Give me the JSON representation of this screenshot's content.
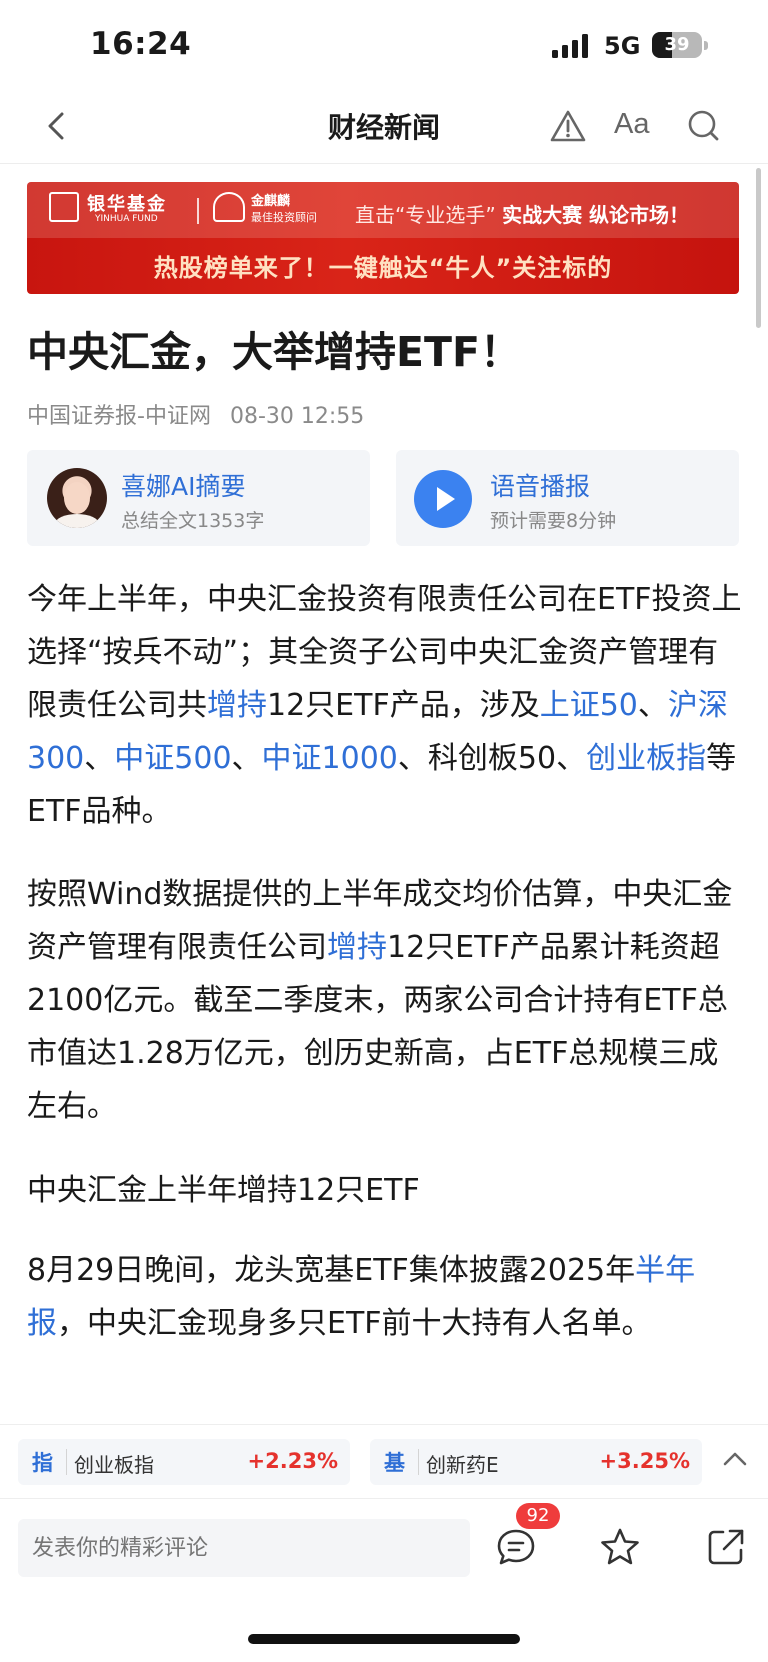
{
  "status_bar": {
    "time": "16:24",
    "network": "5G",
    "battery": "39",
    "battery_level": 0.39
  },
  "nav": {
    "title": "财经新闻",
    "font_button": "Aa"
  },
  "banner": {
    "logo1_cn": "银华基金",
    "logo1_en": "YINHUA FUND",
    "logo2_name": "金麒麟",
    "logo2_sub": "最佳投资顾问",
    "slogan_prefix": "直击“专业选手”",
    "slogan_bold": "实战大赛 纵论市场！",
    "headline": "热股榜单来了！一键触达“牛人”关注标的"
  },
  "article": {
    "title": "中央汇金，大举增持ETF！",
    "source": "中国证券报-中证网",
    "date": "08-30 12:55"
  },
  "cards": {
    "ai_title": "喜娜AI摘要",
    "ai_sub": "总结全文1353字",
    "voice_title": "语音播报",
    "voice_sub": "预计需要8分钟"
  },
  "content": {
    "p1": {
      "t1": "今年上半年，中央汇金投资有限责任公司在ETF投资上选择“按兵不动”；其全资子公司中央汇金资产管理有限责任公司共",
      "l1": "增持",
      "t2": "12只ETF产品，涉及",
      "l2": "上证50",
      "t3": "、",
      "l3": "沪深300",
      "t4": "、",
      "l4": "中证500",
      "t5": "、",
      "l5": "中证1000",
      "t6": "、科创板50、",
      "l6": "创业板指",
      "t7": "等ETF品种。"
    },
    "p2": {
      "t1": "按照Wind数据提供的上半年成交均价估算，中央汇金资产管理有限责任公司",
      "l1": "增持",
      "t2": "12只ETF产品累计耗资超2100亿元。截至二季度末，两家公司合计持有ETF总市值达1.28万亿元，创历史新高，占ETF总规模三成左右。"
    },
    "p3": "中央汇金上半年增持12只ETF",
    "p4": {
      "t1": "8月29日晚间，龙头宽基ETF集体披露2025年",
      "l1": "半年报",
      "t2": "，中央汇金现身多只ETF前十大持有人名单。"
    }
  },
  "tickers": [
    {
      "type": "指",
      "name": "创业板指",
      "change": "+2.23%"
    },
    {
      "type": "基",
      "name": "创新药E",
      "change": "+3.25%"
    }
  ],
  "action_bar": {
    "comment_placeholder": "发表你的精彩评论",
    "comment_count": "92"
  },
  "colors": {
    "link": "#2f6fd6",
    "banner_red": "#d92418",
    "rise": "#e5322d",
    "badge": "#ef3c3c"
  },
  "icons": [
    "back-icon",
    "warning-icon",
    "search-icon",
    "play-icon",
    "chevron-up-icon",
    "comment-icon",
    "star-icon",
    "share-icon"
  ]
}
